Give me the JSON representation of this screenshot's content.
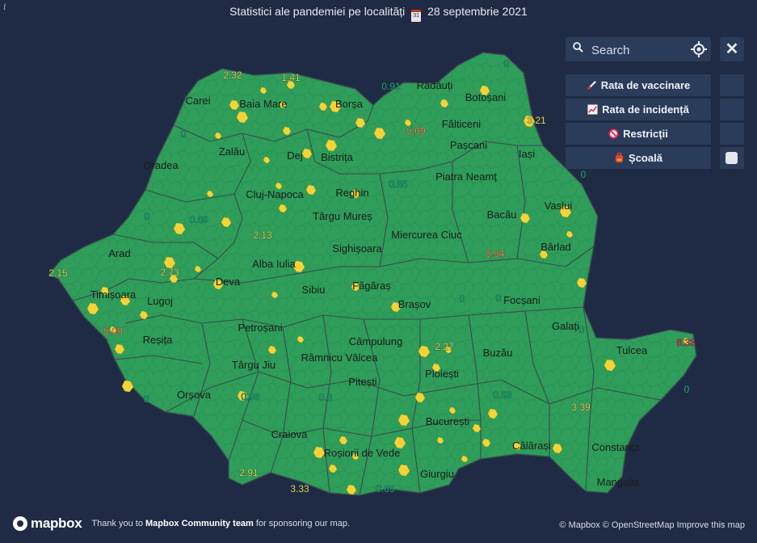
{
  "header": {
    "info_glyph": "i",
    "title_prefix": "Statistici ale pandemiei pe localități",
    "date": "28 septembrie 2021",
    "calendar_glyph": "31"
  },
  "search": {
    "placeholder": "Search"
  },
  "close_label": "✕",
  "layers": [
    {
      "label": "Rata de vaccinare",
      "icon": "syringe-icon",
      "enabled": false
    },
    {
      "label": "Rata de incidență",
      "icon": "chart-icon",
      "enabled": false
    },
    {
      "label": "Restricții",
      "icon": "no-entry-icon",
      "enabled": false
    },
    {
      "label": "Școală",
      "icon": "backpack-icon",
      "enabled": true
    }
  ],
  "colors": {
    "background": "#1f2b44",
    "map_fill": "#2e9e5a",
    "border": "#3b4a4e",
    "hotspot": "#f2d43a",
    "panel": "#2b3b5a",
    "rate_green": "#1aa86a",
    "rate_yellow": "#d8d34a",
    "rate_orange": "#f08a3a",
    "rate_red": "#e8234a"
  },
  "cities": [
    "Carei",
    "Baia Mare",
    "Borșa",
    "Rădăuți",
    "Botoșani",
    "Fălticeni",
    "Pașcani",
    "Iași",
    "Zalău",
    "Dej",
    "Bistrița",
    "Oradea",
    "Cluj-Napoca",
    "Reghin",
    "Piatra Neamț",
    "Târgu Mureș",
    "Bacău",
    "Vaslui",
    "Miercurea Ciuc",
    "Bârlad",
    "Arad",
    "Alba Iulia",
    "Sighișoara",
    "Timișoara",
    "Deva",
    "Sibiu",
    "Făgăraș",
    "Lugoj",
    "Brașov",
    "Focșani",
    "Galați",
    "Reșița",
    "Petroșani",
    "Câmpulung",
    "Tulcea",
    "Râmnicu Vâlcea",
    "Buzău",
    "Târgu Jiu",
    "Ploiești",
    "Orșova",
    "Pitești",
    "București",
    "Craiova",
    "Călărași",
    "Constanța",
    "Roșiorii de Vede",
    "Giurgiu",
    "Mangalia"
  ],
  "rates": [
    {
      "value": "2.32",
      "level": "yellow"
    },
    {
      "value": "1.41",
      "level": "yellow"
    },
    {
      "value": "0.91",
      "level": "green"
    },
    {
      "value": "5.09",
      "level": "orange"
    },
    {
      "value": "3.21",
      "level": "yellow"
    },
    {
      "value": "0",
      "level": "green"
    },
    {
      "value": "0",
      "level": "green"
    },
    {
      "value": "0.85",
      "level": "green"
    },
    {
      "value": "0",
      "level": "green"
    },
    {
      "value": "0.69",
      "level": "green"
    },
    {
      "value": "2.13",
      "level": "yellow"
    },
    {
      "value": "5.54",
      "level": "orange"
    },
    {
      "value": "2.15",
      "level": "yellow"
    },
    {
      "value": "2.73",
      "level": "yellow"
    },
    {
      "value": "0",
      "level": "green"
    },
    {
      "value": "5.09",
      "level": "orange"
    },
    {
      "value": "8.33",
      "level": "red"
    },
    {
      "value": "2.27",
      "level": "yellow"
    },
    {
      "value": "0",
      "level": "green"
    },
    {
      "value": "0.96",
      "level": "green"
    },
    {
      "value": "0.8",
      "level": "green"
    },
    {
      "value": "0.53",
      "level": "green"
    },
    {
      "value": "3.39",
      "level": "yellow"
    },
    {
      "value": "0",
      "level": "green"
    },
    {
      "value": "2.91",
      "level": "yellow"
    },
    {
      "value": "3.33",
      "level": "yellow"
    },
    {
      "value": "0.69",
      "level": "green"
    },
    {
      "value": "0",
      "level": "green"
    },
    {
      "value": "0",
      "level": "green"
    },
    {
      "value": "0",
      "level": "green"
    }
  ],
  "footer": {
    "logo_text": "mapbox",
    "thanks_prefix": "Thank you to",
    "thanks_team": "Mapbox Community team",
    "thanks_suffix": "for sponsoring our map.",
    "attribution": "© Mapbox © OpenStreetMap Improve this map"
  }
}
